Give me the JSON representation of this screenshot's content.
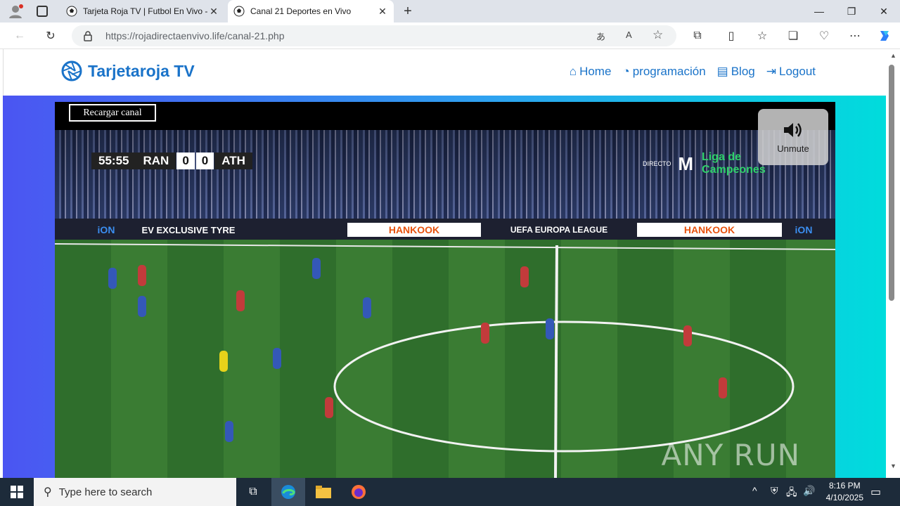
{
  "browser": {
    "tabs": [
      {
        "title": "Tarjeta Roja TV | Futbol En Vivo - ",
        "active": false
      },
      {
        "title": "Canal 21 Deportes en Vivo",
        "active": true
      }
    ],
    "url_host": "https://rojadirectaenvivo.life",
    "url_path": "/canal-21.php"
  },
  "site": {
    "brand": "Tarjetaroja TV",
    "nav": [
      {
        "label": "Home",
        "icon": "home-icon"
      },
      {
        "label": "programación",
        "icon": "dashboard-icon"
      },
      {
        "label": "Blog",
        "icon": "newspaper-icon"
      },
      {
        "label": "Logout",
        "icon": "logout-icon"
      }
    ],
    "accent": "#1a73c9"
  },
  "player": {
    "reload_label": "Recargar canal",
    "unmute_label": "Unmute",
    "scorebug": {
      "clock": "55:55",
      "home": "RAN",
      "home_score": "0",
      "away_score": "0",
      "away": "ATH"
    },
    "broadcast": {
      "directo": "DIRECTO",
      "liga_line1": "Liga de",
      "liga_line2": "Campeones"
    },
    "ads": {
      "ion": "iON",
      "ev": "EV EXCLUSIVE TYRE",
      "hankook": "HANKOOK",
      "uel": "UEFA EUROPA LEAGUE"
    }
  },
  "watermark": "ANY RUN",
  "taskbar": {
    "search_placeholder": "Type here to search",
    "time": "8:16 PM",
    "date": "4/10/2025"
  }
}
